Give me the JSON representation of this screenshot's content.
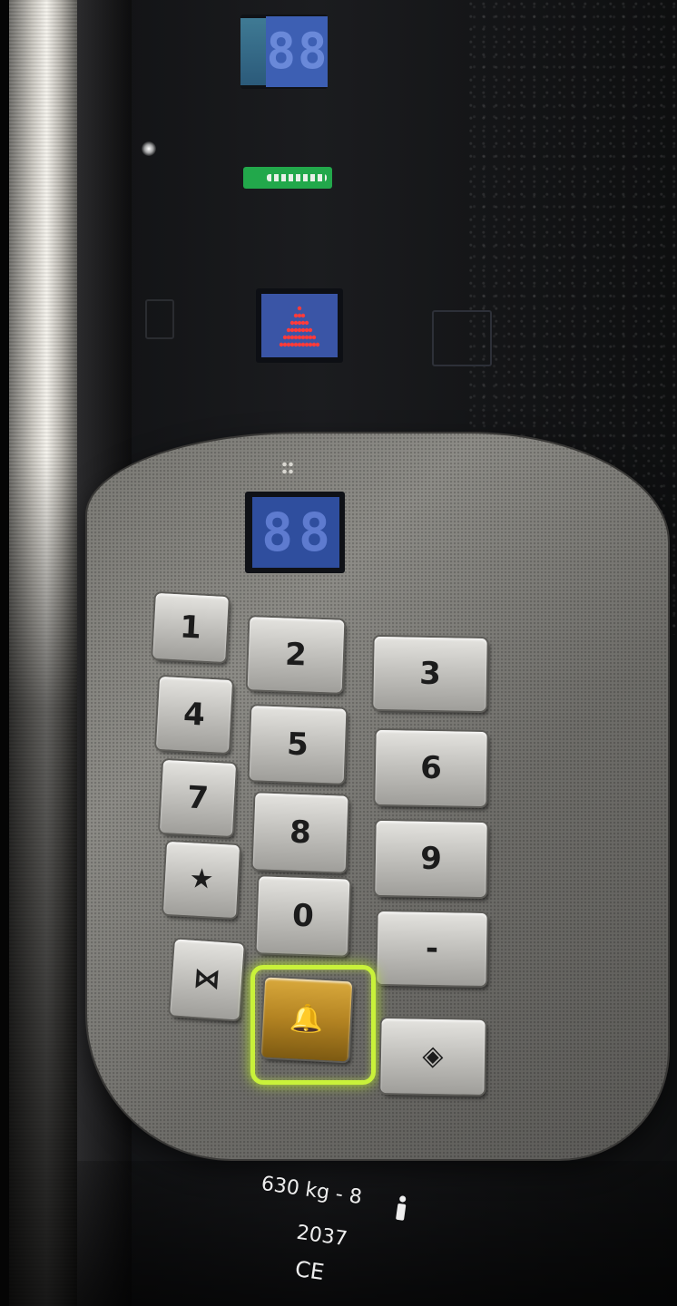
{
  "top_display": {
    "digits": [
      "8",
      "8"
    ]
  },
  "direction_indicator": {
    "icon": "up-arrow-icon",
    "color": "#ff3b3b"
  },
  "car_display": {
    "digits": [
      "8",
      "8"
    ]
  },
  "keypad": {
    "keys": [
      {
        "name": "key-1",
        "label": "1"
      },
      {
        "name": "key-2",
        "label": "2"
      },
      {
        "name": "key-3",
        "label": "3"
      },
      {
        "name": "key-4",
        "label": "4"
      },
      {
        "name": "key-5",
        "label": "5"
      },
      {
        "name": "key-6",
        "label": "6"
      },
      {
        "name": "key-7",
        "label": "7"
      },
      {
        "name": "key-8",
        "label": "8"
      },
      {
        "name": "key-9",
        "label": "9"
      },
      {
        "name": "key-star",
        "label": "★"
      },
      {
        "name": "key-0",
        "label": "0"
      },
      {
        "name": "key-dash",
        "label": "-"
      },
      {
        "name": "key-door-close",
        "label": "⋈"
      },
      {
        "name": "key-alarm",
        "label": "🔔"
      },
      {
        "name": "key-door-open",
        "label": "◈"
      }
    ],
    "alarm_glow_color": "#c9f23a"
  },
  "capacity_label": {
    "load": "630 kg",
    "separator": "-",
    "persons": "8",
    "year": "2037",
    "mark": "CE"
  }
}
